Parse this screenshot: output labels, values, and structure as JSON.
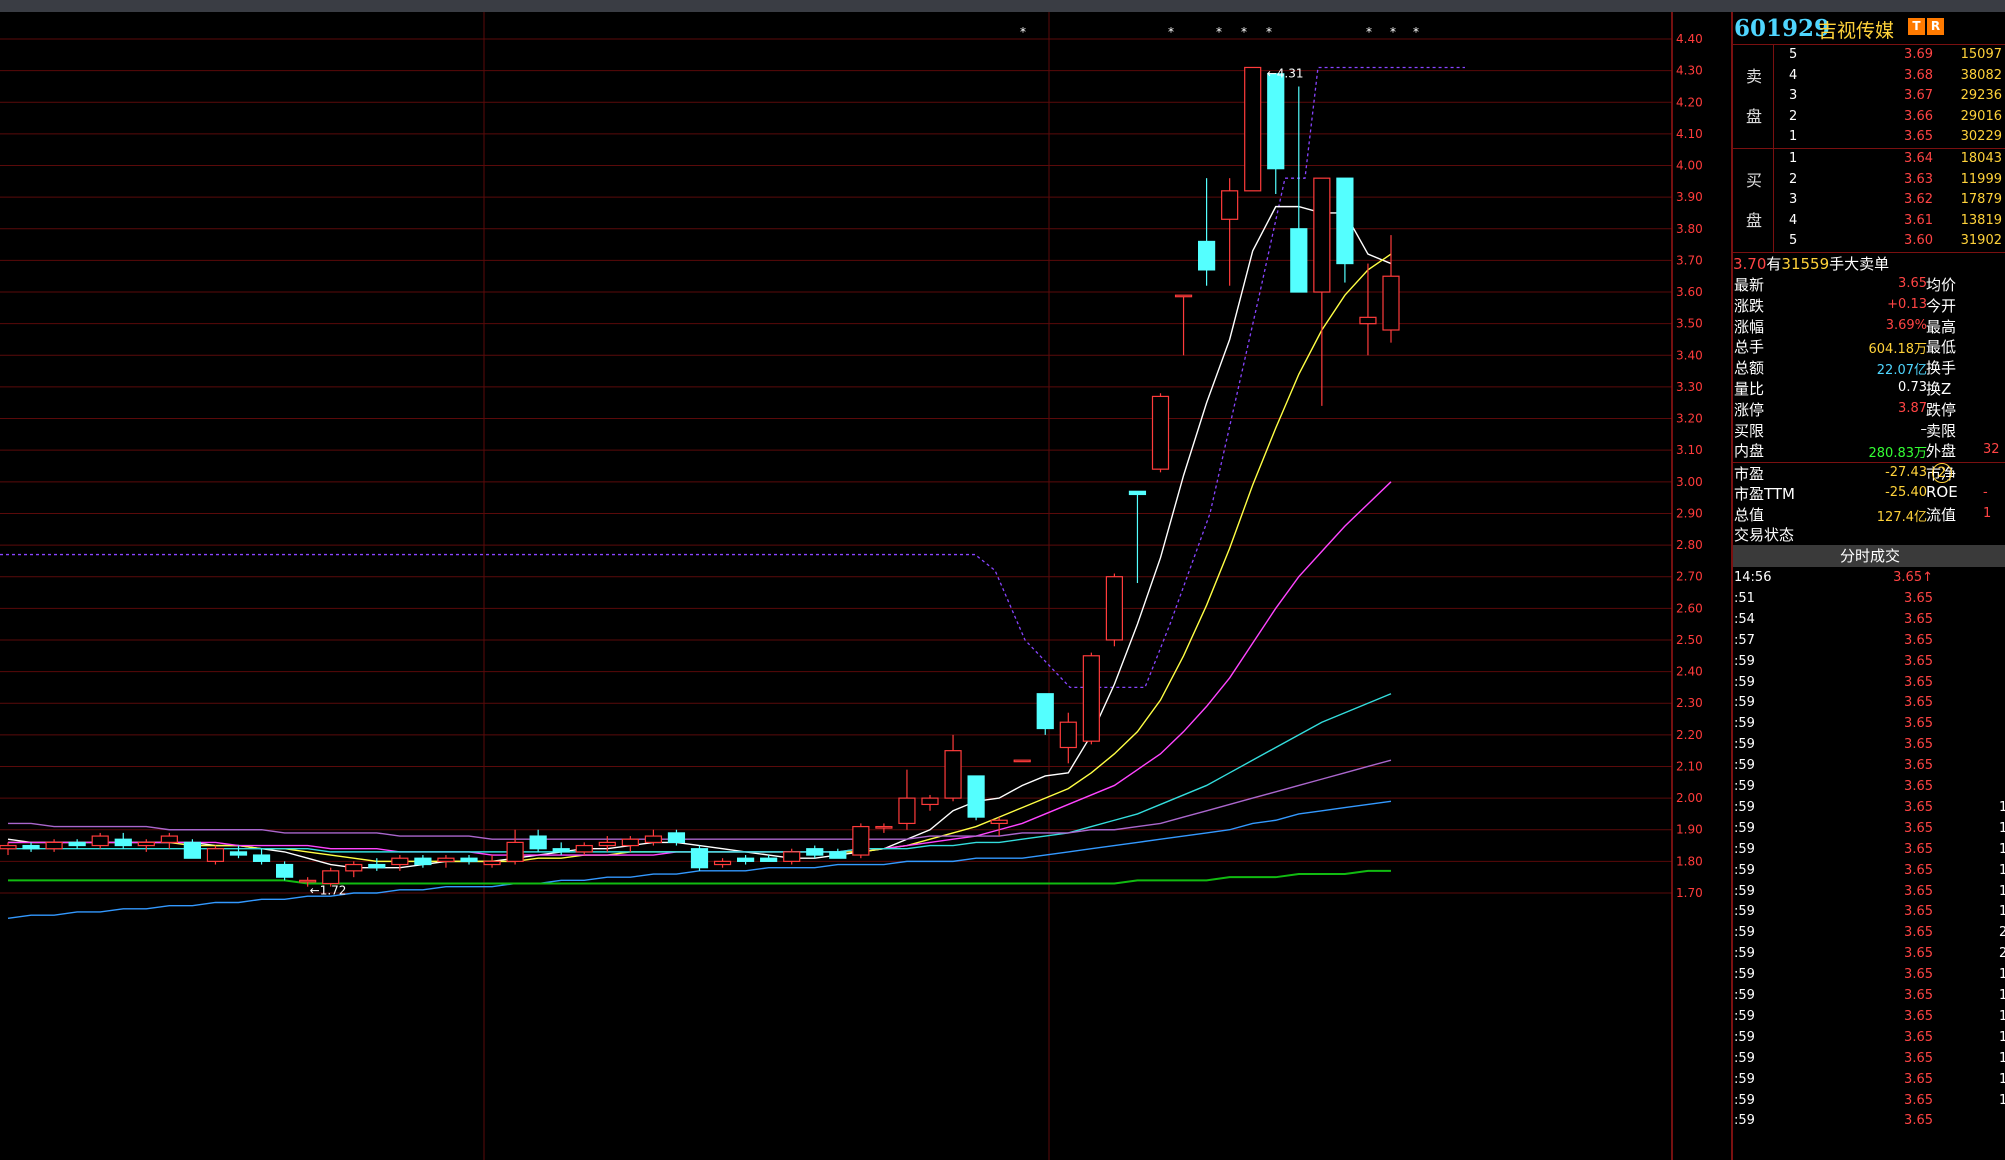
{
  "colors": {
    "up": "#ff3b3b",
    "down": "#54ffff",
    "ma1": "#ffffff",
    "ma2": "#ffff44",
    "ma3": "#ff44ff",
    "ma4": "#33dddd",
    "ma5": "#aa66cc",
    "ma6": "#3399ff",
    "ma7": "#11bb11",
    "resistance": "#8844ff",
    "grid": "#5a0a0a",
    "axis_text": "#ff3b3b"
  },
  "chart_data": {
    "type": "candlestick",
    "ylim": [
      1.65,
      4.45
    ],
    "y_ticks": [
      "4.40",
      "4.30",
      "4.20",
      "4.10",
      "4.00",
      "3.90",
      "3.80",
      "3.70",
      "3.60",
      "3.50",
      "3.40",
      "3.30",
      "3.20",
      "3.10",
      "3.00",
      "2.90",
      "2.80",
      "2.70",
      "2.60",
      "2.50",
      "2.40",
      "2.30",
      "2.20",
      "2.10",
      "2.00",
      "1.90",
      "1.80",
      "1.70"
    ],
    "annotations": {
      "high_label": "4.31",
      "low_label": "1.72"
    },
    "markers": [
      "*",
      "*",
      "*",
      "*",
      "*",
      "*",
      "*",
      "*"
    ],
    "candles": [
      {
        "o": 1.84,
        "h": 1.86,
        "l": 1.82,
        "c": 1.85
      },
      {
        "o": 1.85,
        "h": 1.86,
        "l": 1.83,
        "c": 1.84
      },
      {
        "o": 1.84,
        "h": 1.87,
        "l": 1.83,
        "c": 1.86
      },
      {
        "o": 1.86,
        "h": 1.87,
        "l": 1.84,
        "c": 1.85
      },
      {
        "o": 1.85,
        "h": 1.89,
        "l": 1.84,
        "c": 1.88
      },
      {
        "o": 1.87,
        "h": 1.89,
        "l": 1.84,
        "c": 1.85
      },
      {
        "o": 1.85,
        "h": 1.87,
        "l": 1.83,
        "c": 1.86
      },
      {
        "o": 1.86,
        "h": 1.89,
        "l": 1.84,
        "c": 1.88
      },
      {
        "o": 1.86,
        "h": 1.87,
        "l": 1.81,
        "c": 1.81
      },
      {
        "o": 1.8,
        "h": 1.85,
        "l": 1.79,
        "c": 1.84
      },
      {
        "o": 1.83,
        "h": 1.85,
        "l": 1.81,
        "c": 1.82
      },
      {
        "o": 1.82,
        "h": 1.84,
        "l": 1.79,
        "c": 1.8
      },
      {
        "o": 1.79,
        "h": 1.8,
        "l": 1.74,
        "c": 1.75
      },
      {
        "o": 1.74,
        "h": 1.75,
        "l": 1.72,
        "c": 1.74
      },
      {
        "o": 1.73,
        "h": 1.78,
        "l": 1.72,
        "c": 1.77
      },
      {
        "o": 1.77,
        "h": 1.8,
        "l": 1.75,
        "c": 1.79
      },
      {
        "o": 1.79,
        "h": 1.81,
        "l": 1.77,
        "c": 1.78
      },
      {
        "o": 1.79,
        "h": 1.82,
        "l": 1.77,
        "c": 1.81
      },
      {
        "o": 1.81,
        "h": 1.82,
        "l": 1.78,
        "c": 1.79
      },
      {
        "o": 1.8,
        "h": 1.82,
        "l": 1.78,
        "c": 1.81
      },
      {
        "o": 1.81,
        "h": 1.82,
        "l": 1.79,
        "c": 1.8
      },
      {
        "o": 1.79,
        "h": 1.82,
        "l": 1.78,
        "c": 1.8
      },
      {
        "o": 1.8,
        "h": 1.9,
        "l": 1.79,
        "c": 1.86
      },
      {
        "o": 1.88,
        "h": 1.9,
        "l": 1.83,
        "c": 1.84
      },
      {
        "o": 1.84,
        "h": 1.86,
        "l": 1.82,
        "c": 1.83
      },
      {
        "o": 1.83,
        "h": 1.86,
        "l": 1.82,
        "c": 1.85
      },
      {
        "o": 1.85,
        "h": 1.88,
        "l": 1.83,
        "c": 1.86
      },
      {
        "o": 1.85,
        "h": 1.88,
        "l": 1.83,
        "c": 1.87
      },
      {
        "o": 1.86,
        "h": 1.9,
        "l": 1.85,
        "c": 1.88
      },
      {
        "o": 1.89,
        "h": 1.9,
        "l": 1.85,
        "c": 1.86
      },
      {
        "o": 1.84,
        "h": 1.85,
        "l": 1.77,
        "c": 1.78
      },
      {
        "o": 1.79,
        "h": 1.81,
        "l": 1.78,
        "c": 1.8
      },
      {
        "o": 1.81,
        "h": 1.82,
        "l": 1.79,
        "c": 1.8
      },
      {
        "o": 1.81,
        "h": 1.82,
        "l": 1.8,
        "c": 1.8
      },
      {
        "o": 1.8,
        "h": 1.84,
        "l": 1.79,
        "c": 1.83
      },
      {
        "o": 1.84,
        "h": 1.85,
        "l": 1.81,
        "c": 1.82
      },
      {
        "o": 1.83,
        "h": 1.84,
        "l": 1.81,
        "c": 1.81
      },
      {
        "o": 1.82,
        "h": 1.92,
        "l": 1.81,
        "c": 1.91
      },
      {
        "o": 1.91,
        "h": 1.92,
        "l": 1.89,
        "c": 1.91
      },
      {
        "o": 1.92,
        "h": 2.09,
        "l": 1.9,
        "c": 2.0
      },
      {
        "o": 1.98,
        "h": 2.01,
        "l": 1.96,
        "c": 2.0
      },
      {
        "o": 2.0,
        "h": 2.2,
        "l": 1.99,
        "c": 2.15
      },
      {
        "o": 2.07,
        "h": 2.07,
        "l": 1.93,
        "c": 1.94
      },
      {
        "o": 1.92,
        "h": 1.94,
        "l": 1.88,
        "c": 1.93
      },
      {
        "o": 2.12,
        "h": 2.12,
        "l": 2.12,
        "c": 2.12
      },
      {
        "o": 2.33,
        "h": 2.33,
        "l": 2.2,
        "c": 2.22
      },
      {
        "o": 2.16,
        "h": 2.27,
        "l": 2.11,
        "c": 2.24
      },
      {
        "o": 2.18,
        "h": 2.46,
        "l": 2.17,
        "c": 2.45
      },
      {
        "o": 2.5,
        "h": 2.71,
        "l": 2.48,
        "c": 2.7
      },
      {
        "o": 2.97,
        "h": 2.97,
        "l": 2.68,
        "c": 2.96
      },
      {
        "o": 3.04,
        "h": 3.28,
        "l": 3.03,
        "c": 3.27
      },
      {
        "o": 3.59,
        "h": 3.59,
        "l": 3.4,
        "c": 3.59
      },
      {
        "o": 3.76,
        "h": 3.96,
        "l": 3.62,
        "c": 3.67
      },
      {
        "o": 3.83,
        "h": 3.96,
        "l": 3.62,
        "c": 3.92
      },
      {
        "o": 3.92,
        "h": 4.31,
        "l": 3.92,
        "c": 4.31
      },
      {
        "o": 4.29,
        "h": 4.29,
        "l": 3.91,
        "c": 3.99
      },
      {
        "o": 3.8,
        "h": 4.25,
        "l": 3.6,
        "c": 3.6
      },
      {
        "o": 3.6,
        "h": 3.96,
        "l": 3.24,
        "c": 3.96
      },
      {
        "o": 3.96,
        "h": 3.96,
        "l": 3.63,
        "c": 3.69
      },
      {
        "o": 3.5,
        "h": 3.69,
        "l": 3.4,
        "c": 3.52
      },
      {
        "o": 3.48,
        "h": 3.78,
        "l": 3.44,
        "c": 3.65
      }
    ],
    "ma_lines": [
      {
        "name": "ma1",
        "values": [
          1.87,
          1.86,
          1.86,
          1.86,
          1.86,
          1.86,
          1.86,
          1.86,
          1.86,
          1.85,
          1.85,
          1.84,
          1.83,
          1.81,
          1.79,
          1.78,
          1.78,
          1.78,
          1.79,
          1.8,
          1.8,
          1.8,
          1.81,
          1.82,
          1.83,
          1.84,
          1.84,
          1.85,
          1.86,
          1.86,
          1.85,
          1.84,
          1.83,
          1.82,
          1.81,
          1.81,
          1.82,
          1.83,
          1.84,
          1.87,
          1.9,
          1.96,
          1.99,
          2.0,
          2.04,
          2.07,
          2.08,
          2.2,
          2.36,
          2.55,
          2.76,
          3.02,
          3.25,
          3.45,
          3.73,
          3.87,
          3.87,
          3.85,
          3.85,
          3.72,
          3.69
        ]
      },
      {
        "name": "ma2",
        "values": [
          1.86,
          1.86,
          1.86,
          1.86,
          1.86,
          1.86,
          1.86,
          1.86,
          1.85,
          1.85,
          1.85,
          1.84,
          1.84,
          1.83,
          1.82,
          1.81,
          1.8,
          1.8,
          1.8,
          1.8,
          1.8,
          1.8,
          1.8,
          1.81,
          1.81,
          1.82,
          1.82,
          1.83,
          1.83,
          1.83,
          1.83,
          1.83,
          1.83,
          1.83,
          1.83,
          1.83,
          1.83,
          1.83,
          1.84,
          1.85,
          1.87,
          1.89,
          1.91,
          1.94,
          1.97,
          2.0,
          2.03,
          2.08,
          2.14,
          2.21,
          2.31,
          2.45,
          2.61,
          2.79,
          2.99,
          3.17,
          3.34,
          3.48,
          3.59,
          3.67,
          3.72
        ]
      },
      {
        "name": "ma3",
        "values": [
          1.86,
          1.86,
          1.86,
          1.86,
          1.86,
          1.86,
          1.86,
          1.86,
          1.86,
          1.86,
          1.85,
          1.85,
          1.85,
          1.85,
          1.84,
          1.84,
          1.84,
          1.83,
          1.83,
          1.83,
          1.83,
          1.82,
          1.82,
          1.82,
          1.82,
          1.82,
          1.82,
          1.82,
          1.82,
          1.83,
          1.83,
          1.83,
          1.83,
          1.83,
          1.83,
          1.83,
          1.83,
          1.84,
          1.84,
          1.85,
          1.86,
          1.87,
          1.88,
          1.9,
          1.92,
          1.95,
          1.98,
          2.01,
          2.04,
          2.09,
          2.14,
          2.21,
          2.29,
          2.38,
          2.49,
          2.6,
          2.7,
          2.78,
          2.86,
          2.93,
          3.0
        ]
      },
      {
        "name": "ma4",
        "values": [
          1.84,
          1.84,
          1.84,
          1.84,
          1.84,
          1.84,
          1.84,
          1.84,
          1.84,
          1.84,
          1.84,
          1.84,
          1.84,
          1.84,
          1.83,
          1.83,
          1.83,
          1.83,
          1.83,
          1.83,
          1.83,
          1.83,
          1.83,
          1.83,
          1.83,
          1.83,
          1.83,
          1.83,
          1.83,
          1.83,
          1.83,
          1.83,
          1.83,
          1.83,
          1.83,
          1.83,
          1.83,
          1.84,
          1.84,
          1.84,
          1.85,
          1.85,
          1.86,
          1.86,
          1.87,
          1.88,
          1.89,
          1.91,
          1.93,
          1.95,
          1.98,
          2.01,
          2.04,
          2.08,
          2.12,
          2.16,
          2.2,
          2.24,
          2.27,
          2.3,
          2.33
        ]
      },
      {
        "name": "ma5",
        "values": [
          1.92,
          1.92,
          1.91,
          1.91,
          1.91,
          1.91,
          1.91,
          1.9,
          1.9,
          1.9,
          1.9,
          1.9,
          1.89,
          1.89,
          1.89,
          1.89,
          1.89,
          1.88,
          1.88,
          1.88,
          1.88,
          1.87,
          1.87,
          1.87,
          1.87,
          1.87,
          1.87,
          1.87,
          1.87,
          1.87,
          1.87,
          1.87,
          1.87,
          1.87,
          1.87,
          1.87,
          1.87,
          1.87,
          1.87,
          1.87,
          1.88,
          1.88,
          1.88,
          1.88,
          1.89,
          1.89,
          1.89,
          1.9,
          1.9,
          1.91,
          1.92,
          1.94,
          1.96,
          1.98,
          2.0,
          2.02,
          2.04,
          2.06,
          2.08,
          2.1,
          2.12
        ]
      },
      {
        "name": "ma6",
        "values": [
          1.62,
          1.63,
          1.63,
          1.64,
          1.64,
          1.65,
          1.65,
          1.66,
          1.66,
          1.67,
          1.67,
          1.68,
          1.68,
          1.69,
          1.69,
          1.7,
          1.7,
          1.71,
          1.71,
          1.72,
          1.72,
          1.72,
          1.73,
          1.73,
          1.74,
          1.74,
          1.75,
          1.75,
          1.76,
          1.76,
          1.77,
          1.77,
          1.77,
          1.78,
          1.78,
          1.78,
          1.79,
          1.79,
          1.79,
          1.8,
          1.8,
          1.8,
          1.81,
          1.81,
          1.81,
          1.82,
          1.83,
          1.84,
          1.85,
          1.86,
          1.87,
          1.88,
          1.89,
          1.9,
          1.92,
          1.93,
          1.95,
          1.96,
          1.97,
          1.98,
          1.99
        ]
      },
      {
        "name": "ma7",
        "values": [
          1.74,
          1.74,
          1.74,
          1.74,
          1.74,
          1.74,
          1.74,
          1.74,
          1.74,
          1.74,
          1.74,
          1.74,
          1.74,
          1.73,
          1.73,
          1.73,
          1.73,
          1.73,
          1.73,
          1.73,
          1.73,
          1.73,
          1.73,
          1.73,
          1.73,
          1.73,
          1.73,
          1.73,
          1.73,
          1.73,
          1.73,
          1.73,
          1.73,
          1.73,
          1.73,
          1.73,
          1.73,
          1.73,
          1.73,
          1.73,
          1.73,
          1.73,
          1.73,
          1.73,
          1.73,
          1.73,
          1.73,
          1.73,
          1.73,
          1.74,
          1.74,
          1.74,
          1.74,
          1.75,
          1.75,
          1.75,
          1.76,
          1.76,
          1.76,
          1.77,
          1.77
        ]
      }
    ]
  },
  "panel": {
    "code": "601929",
    "name": "吉视传媒",
    "badge1": "T",
    "badge2": "R",
    "sell_label_1": "卖",
    "sell_label_2": "盘",
    "buy_label_1": "买",
    "buy_label_2": "盘",
    "sell": [
      {
        "lv": "5",
        "price": "3.69",
        "vol": "15097"
      },
      {
        "lv": "4",
        "price": "3.68",
        "vol": "38082"
      },
      {
        "lv": "3",
        "price": "3.67",
        "vol": "29236"
      },
      {
        "lv": "2",
        "price": "3.66",
        "vol": "29016"
      },
      {
        "lv": "1",
        "price": "3.65",
        "vol": "30229"
      }
    ],
    "buy": [
      {
        "lv": "1",
        "price": "3.64",
        "vol": "18043"
      },
      {
        "lv": "2",
        "price": "3.63",
        "vol": "11999"
      },
      {
        "lv": "3",
        "price": "3.62",
        "vol": "17879"
      },
      {
        "lv": "4",
        "price": "3.61",
        "vol": "13819"
      },
      {
        "lv": "5",
        "price": "3.60",
        "vol": "31902"
      }
    ],
    "big_order": {
      "price": "3.70",
      "t1": "有",
      "amount": "31559",
      "t2": "手大卖单"
    },
    "quote": [
      {
        "l": "最新",
        "v": "3.65",
        "vc": "#ff4444",
        "r": "均价",
        "rv": ""
      },
      {
        "l": "涨跌",
        "v": "+0.13",
        "vc": "#ff4444",
        "r": "今开",
        "rv": ""
      },
      {
        "l": "涨幅",
        "v": "3.69%",
        "vc": "#ff4444",
        "r": "最高",
        "rv": ""
      },
      {
        "l": "总手",
        "v": "604.18万",
        "vc": "#ffd23a",
        "r": "最低",
        "rv": ""
      },
      {
        "l": "总额",
        "v": "22.07亿",
        "vc": "#4fd6ff",
        "r": "换手",
        "rv": ""
      },
      {
        "l": "量比",
        "v": "0.73",
        "vc": "#ffffff",
        "r": "换Z",
        "rv": ""
      },
      {
        "l": "涨停",
        "v": "3.87",
        "vc": "#ff4444",
        "r": "跌停",
        "rv": ""
      },
      {
        "l": "买限",
        "v": "–",
        "vc": "#ffffff",
        "r": "卖限",
        "rv": ""
      },
      {
        "l": "内盘",
        "v": "280.83万",
        "vc": "#33ff33",
        "r": "外盘",
        "rv": "32"
      }
    ],
    "quote2": [
      {
        "l": "市盈",
        "v": "-27.43",
        "vc": "#ffd23a",
        "r": "市净",
        "rv": ""
      },
      {
        "l": "市盈TTM",
        "v": "-25.40",
        "vc": "#ffd23a",
        "r": "ROE",
        "rv": "-"
      },
      {
        "l": "总值",
        "v": "127.4亿",
        "vc": "#ffd23a",
        "r": "流值",
        "rv": "1"
      },
      {
        "l": "交易状态",
        "v": "",
        "vc": "#ffffff",
        "r": "",
        "rv": ""
      }
    ],
    "pe_circle": "2",
    "trades_header": "分时成交",
    "trades": [
      {
        "t": "14:56",
        "p": "3.65↑",
        "v": ""
      },
      {
        "t": ":51",
        "p": "3.65",
        "v": ""
      },
      {
        "t": ":54",
        "p": "3.65",
        "v": ""
      },
      {
        "t": ":57",
        "p": "3.65",
        "v": ""
      },
      {
        "t": ":59",
        "p": "3.65",
        "v": ""
      },
      {
        "t": ":59",
        "p": "3.65",
        "v": ""
      },
      {
        "t": ":59",
        "p": "3.65",
        "v": ""
      },
      {
        "t": ":59",
        "p": "3.65",
        "v": ""
      },
      {
        "t": ":59",
        "p": "3.65",
        "v": ""
      },
      {
        "t": ":59",
        "p": "3.65",
        "v": ""
      },
      {
        "t": ":59",
        "p": "3.65",
        "v": ""
      },
      {
        "t": ":59",
        "p": "3.65",
        "v": "1"
      },
      {
        "t": ":59",
        "p": "3.65",
        "v": "1"
      },
      {
        "t": ":59",
        "p": "3.65",
        "v": "1"
      },
      {
        "t": ":59",
        "p": "3.65",
        "v": "1"
      },
      {
        "t": ":59",
        "p": "3.65",
        "v": "1"
      },
      {
        "t": ":59",
        "p": "3.65",
        "v": "1"
      },
      {
        "t": ":59",
        "p": "3.65",
        "v": "2"
      },
      {
        "t": ":59",
        "p": "3.65",
        "v": "2"
      },
      {
        "t": ":59",
        "p": "3.65",
        "v": "1"
      },
      {
        "t": ":59",
        "p": "3.65",
        "v": "1"
      },
      {
        "t": ":59",
        "p": "3.65",
        "v": "1"
      },
      {
        "t": ":59",
        "p": "3.65",
        "v": "1"
      },
      {
        "t": ":59",
        "p": "3.65",
        "v": "1"
      },
      {
        "t": ":59",
        "p": "3.65",
        "v": "1"
      },
      {
        "t": ":59",
        "p": "3.65",
        "v": "1"
      },
      {
        "t": ":59",
        "p": "3.65",
        "v": ""
      }
    ]
  }
}
